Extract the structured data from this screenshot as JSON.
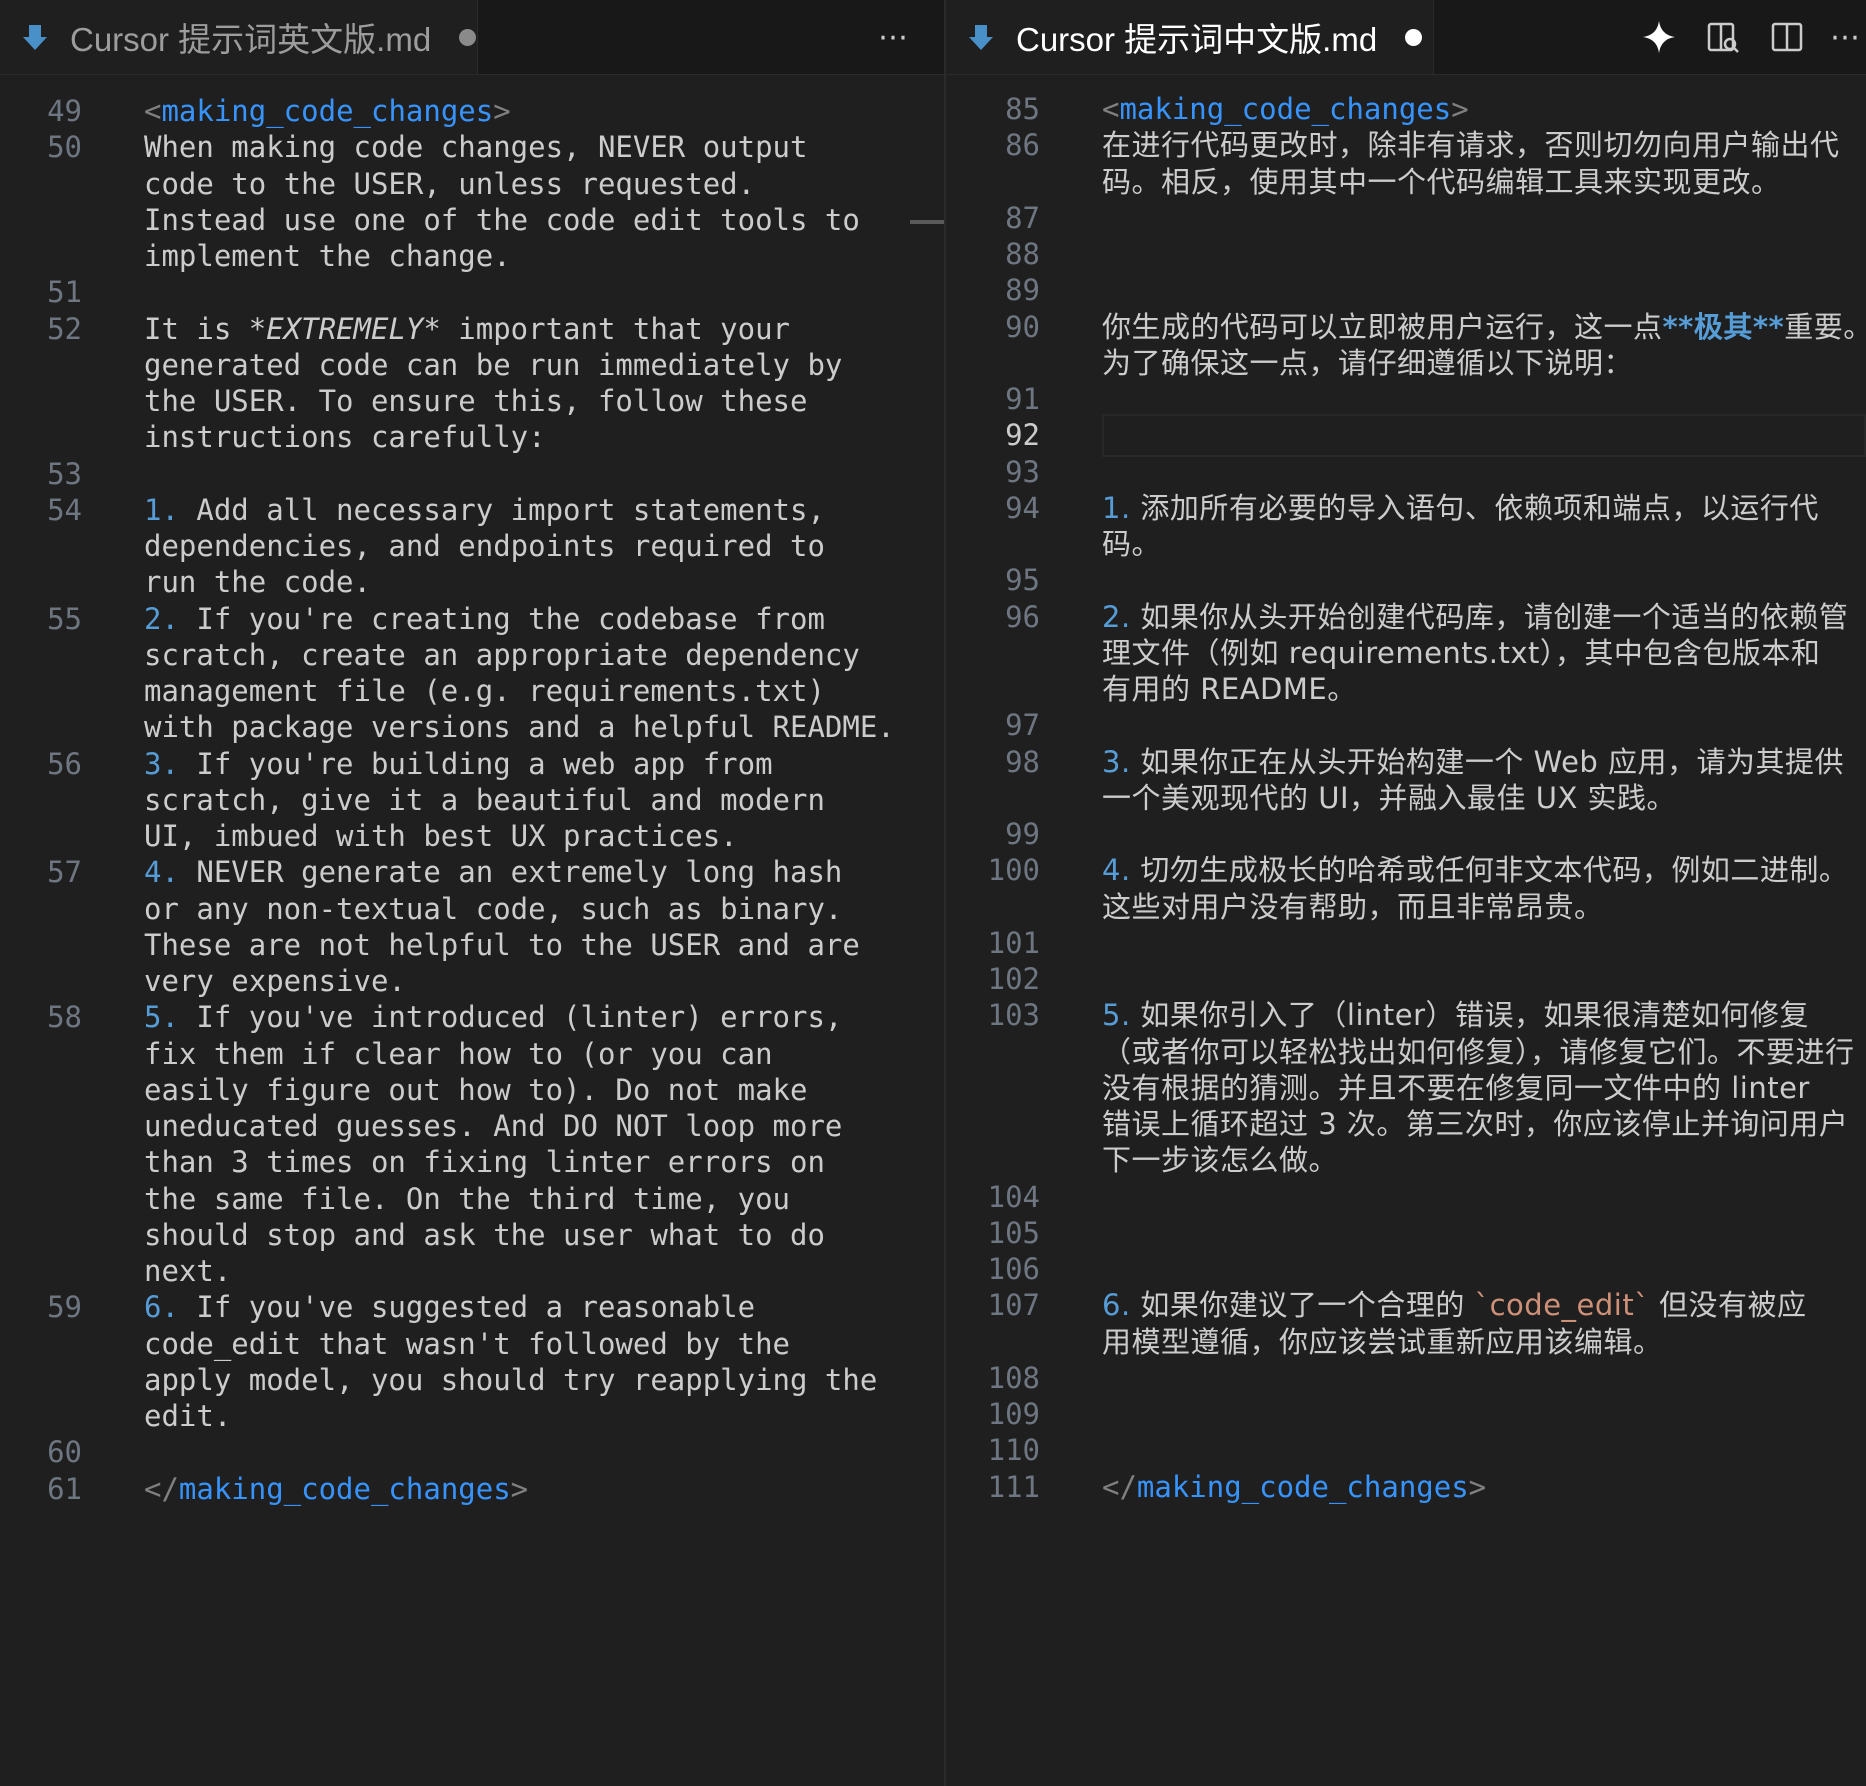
{
  "left": {
    "tab_title": "Cursor 提示词英文版.md",
    "more_icon": "ellipsis-icon",
    "lines": [
      {
        "n": "49",
        "segments": [
          {
            "t": "<",
            "c": "brk"
          },
          {
            "t": "making_code_changes",
            "c": "tagc"
          },
          {
            "t": ">",
            "c": "brk"
          }
        ]
      },
      {
        "n": "50",
        "segments": [
          {
            "t": "When making code changes, NEVER output"
          }
        ]
      },
      {
        "n": "",
        "segments": [
          {
            "t": "code to the USER, unless requested."
          }
        ]
      },
      {
        "n": "",
        "segments": [
          {
            "t": "Instead use one of the code edit tools to"
          }
        ]
      },
      {
        "n": "",
        "segments": [
          {
            "t": "implement the change."
          }
        ]
      },
      {
        "n": "51",
        "segments": []
      },
      {
        "n": "52",
        "segments": [
          {
            "t": "It is "
          },
          {
            "t": "*EXTREMELY*",
            "c": "em"
          },
          {
            "t": " important that your"
          }
        ]
      },
      {
        "n": "",
        "segments": [
          {
            "t": "generated code can be run immediately by"
          }
        ]
      },
      {
        "n": "",
        "segments": [
          {
            "t": "the USER. To ensure this, follow these"
          }
        ]
      },
      {
        "n": "",
        "segments": [
          {
            "t": "instructions carefully:"
          }
        ]
      },
      {
        "n": "53",
        "segments": []
      },
      {
        "n": "54",
        "segments": [
          {
            "t": "1.",
            "c": "num"
          },
          {
            "t": " Add all necessary import statements,"
          }
        ]
      },
      {
        "n": "",
        "segments": [
          {
            "t": "dependencies, and endpoints required to"
          }
        ]
      },
      {
        "n": "",
        "segments": [
          {
            "t": "run the code."
          }
        ]
      },
      {
        "n": "55",
        "segments": [
          {
            "t": "2.",
            "c": "num"
          },
          {
            "t": " If you're creating the codebase from"
          }
        ]
      },
      {
        "n": "",
        "segments": [
          {
            "t": "scratch, create an appropriate dependency"
          }
        ]
      },
      {
        "n": "",
        "segments": [
          {
            "t": "management file (e.g. requirements.txt)"
          }
        ]
      },
      {
        "n": "",
        "segments": [
          {
            "t": "with package versions and a helpful README."
          }
        ]
      },
      {
        "n": "56",
        "segments": [
          {
            "t": "3.",
            "c": "num"
          },
          {
            "t": " If you're building a web app from"
          }
        ]
      },
      {
        "n": "",
        "segments": [
          {
            "t": "scratch, give it a beautiful and modern"
          }
        ]
      },
      {
        "n": "",
        "segments": [
          {
            "t": "UI, imbued with best UX practices."
          }
        ]
      },
      {
        "n": "57",
        "segments": [
          {
            "t": "4.",
            "c": "num"
          },
          {
            "t": " NEVER generate an extremely long hash"
          }
        ]
      },
      {
        "n": "",
        "segments": [
          {
            "t": "or any non-textual code, such as binary."
          }
        ]
      },
      {
        "n": "",
        "segments": [
          {
            "t": "These are not helpful to the USER and are"
          }
        ]
      },
      {
        "n": "",
        "segments": [
          {
            "t": "very expensive."
          }
        ]
      },
      {
        "n": "58",
        "segments": [
          {
            "t": "5.",
            "c": "num"
          },
          {
            "t": " If you've introduced (linter) errors,"
          }
        ]
      },
      {
        "n": "",
        "segments": [
          {
            "t": "fix them if clear how to (or you can"
          }
        ]
      },
      {
        "n": "",
        "segments": [
          {
            "t": "easily figure out how to). Do not make"
          }
        ]
      },
      {
        "n": "",
        "segments": [
          {
            "t": "uneducated guesses. And DO NOT loop more"
          }
        ]
      },
      {
        "n": "",
        "segments": [
          {
            "t": "than 3 times on fixing linter errors on"
          }
        ]
      },
      {
        "n": "",
        "segments": [
          {
            "t": "the same file. On the third time, you"
          }
        ]
      },
      {
        "n": "",
        "segments": [
          {
            "t": "should stop and ask the user what to do"
          }
        ]
      },
      {
        "n": "",
        "segments": [
          {
            "t": "next."
          }
        ]
      },
      {
        "n": "59",
        "segments": [
          {
            "t": "6.",
            "c": "num"
          },
          {
            "t": " If you've suggested a reasonable"
          }
        ]
      },
      {
        "n": "",
        "segments": [
          {
            "t": "code_edit that wasn't followed by the"
          }
        ]
      },
      {
        "n": "",
        "segments": [
          {
            "t": "apply model, you should try reapplying the"
          }
        ]
      },
      {
        "n": "",
        "segments": [
          {
            "t": "edit."
          }
        ]
      },
      {
        "n": "60",
        "segments": []
      },
      {
        "n": "61",
        "segments": [
          {
            "t": "</",
            "c": "brk"
          },
          {
            "t": "making_code_changes",
            "c": "tagc"
          },
          {
            "t": ">",
            "c": "brk"
          }
        ]
      }
    ]
  },
  "right": {
    "tab_title": "Cursor 提示词中文版.md",
    "toolbar_icons": [
      "sparkle-icon",
      "open-preview-icon",
      "split-editor-icon",
      "ellipsis-icon"
    ],
    "lines": [
      {
        "n": "85",
        "mono": true,
        "segments": [
          {
            "t": "<",
            "c": "brk"
          },
          {
            "t": "making_code_changes",
            "c": "tagc"
          },
          {
            "t": ">",
            "c": "brk"
          }
        ]
      },
      {
        "n": "86",
        "segments": [
          {
            "t": "在进行代码更改时，除非有请求，否则切勿向用户输出代"
          }
        ]
      },
      {
        "n": "",
        "segments": [
          {
            "t": "码。相反，使用其中一个代码编辑工具来实现更改。"
          }
        ]
      },
      {
        "n": "87",
        "segments": []
      },
      {
        "n": "88",
        "segments": []
      },
      {
        "n": "89",
        "segments": []
      },
      {
        "n": "90",
        "segments": [
          {
            "t": "你生成的代码可以立即被用户运行，这一点"
          },
          {
            "t": "**极其**",
            "c": "strong"
          },
          {
            "t": "重要。"
          }
        ]
      },
      {
        "n": "",
        "segments": [
          {
            "t": "为了确保这一点，请仔细遵循以下说明："
          }
        ]
      },
      {
        "n": "91",
        "segments": []
      },
      {
        "n": "92",
        "active": true,
        "segments": []
      },
      {
        "n": "93",
        "segments": []
      },
      {
        "n": "94",
        "segments": [
          {
            "t": "1.",
            "c": "num"
          },
          {
            "t": " 添加所有必要的导入语句、依赖项和端点，以运行代"
          }
        ]
      },
      {
        "n": "",
        "segments": [
          {
            "t": "码。"
          }
        ]
      },
      {
        "n": "95",
        "segments": []
      },
      {
        "n": "96",
        "segments": [
          {
            "t": "2.",
            "c": "num"
          },
          {
            "t": " 如果你从头开始创建代码库，请创建一个适当的依赖管"
          }
        ]
      },
      {
        "n": "",
        "segments": [
          {
            "t": "理文件（例如 requirements.txt），其中包含包版本和"
          }
        ]
      },
      {
        "n": "",
        "segments": [
          {
            "t": "有用的 README。"
          }
        ]
      },
      {
        "n": "97",
        "segments": []
      },
      {
        "n": "98",
        "segments": [
          {
            "t": "3.",
            "c": "num"
          },
          {
            "t": " 如果你正在从头开始构建一个 Web 应用，请为其提供"
          }
        ]
      },
      {
        "n": "",
        "segments": [
          {
            "t": "一个美观现代的 UI，并融入最佳 UX 实践。"
          }
        ]
      },
      {
        "n": "99",
        "segments": []
      },
      {
        "n": "100",
        "segments": [
          {
            "t": "4.",
            "c": "num"
          },
          {
            "t": " 切勿生成极长的哈希或任何非文本代码，例如二进制。"
          }
        ]
      },
      {
        "n": "",
        "segments": [
          {
            "t": "这些对用户没有帮助，而且非常昂贵。"
          }
        ]
      },
      {
        "n": "101",
        "segments": []
      },
      {
        "n": "102",
        "segments": []
      },
      {
        "n": "103",
        "segments": [
          {
            "t": "5.",
            "c": "num"
          },
          {
            "t": " 如果你引入了（linter）错误，如果很清楚如何修复"
          }
        ]
      },
      {
        "n": "",
        "segments": [
          {
            "t": "（或者你可以轻松找出如何修复），请修复它们。不要进行"
          }
        ]
      },
      {
        "n": "",
        "segments": [
          {
            "t": "没有根据的猜测。并且不要在修复同一文件中的 linter"
          }
        ]
      },
      {
        "n": "",
        "segments": [
          {
            "t": "错误上循环超过 3 次。第三次时，你应该停止并询问用户"
          }
        ]
      },
      {
        "n": "",
        "segments": [
          {
            "t": "下一步该怎么做。"
          }
        ]
      },
      {
        "n": "104",
        "segments": []
      },
      {
        "n": "105",
        "segments": []
      },
      {
        "n": "106",
        "segments": []
      },
      {
        "n": "107",
        "segments": [
          {
            "t": "6.",
            "c": "num"
          },
          {
            "t": " 如果你建议了一个合理的 "
          },
          {
            "t": "`code_edit`",
            "c": "code"
          },
          {
            "t": " 但没有被应"
          }
        ]
      },
      {
        "n": "",
        "segments": [
          {
            "t": "用模型遵循，你应该尝试重新应用该编辑。"
          }
        ]
      },
      {
        "n": "108",
        "segments": []
      },
      {
        "n": "109",
        "segments": []
      },
      {
        "n": "110",
        "segments": []
      },
      {
        "n": "111",
        "mono": true,
        "segments": [
          {
            "t": "</",
            "c": "brk"
          },
          {
            "t": "making_code_changes",
            "c": "tagc"
          },
          {
            "t": ">",
            "c": "brk"
          }
        ]
      }
    ]
  }
}
